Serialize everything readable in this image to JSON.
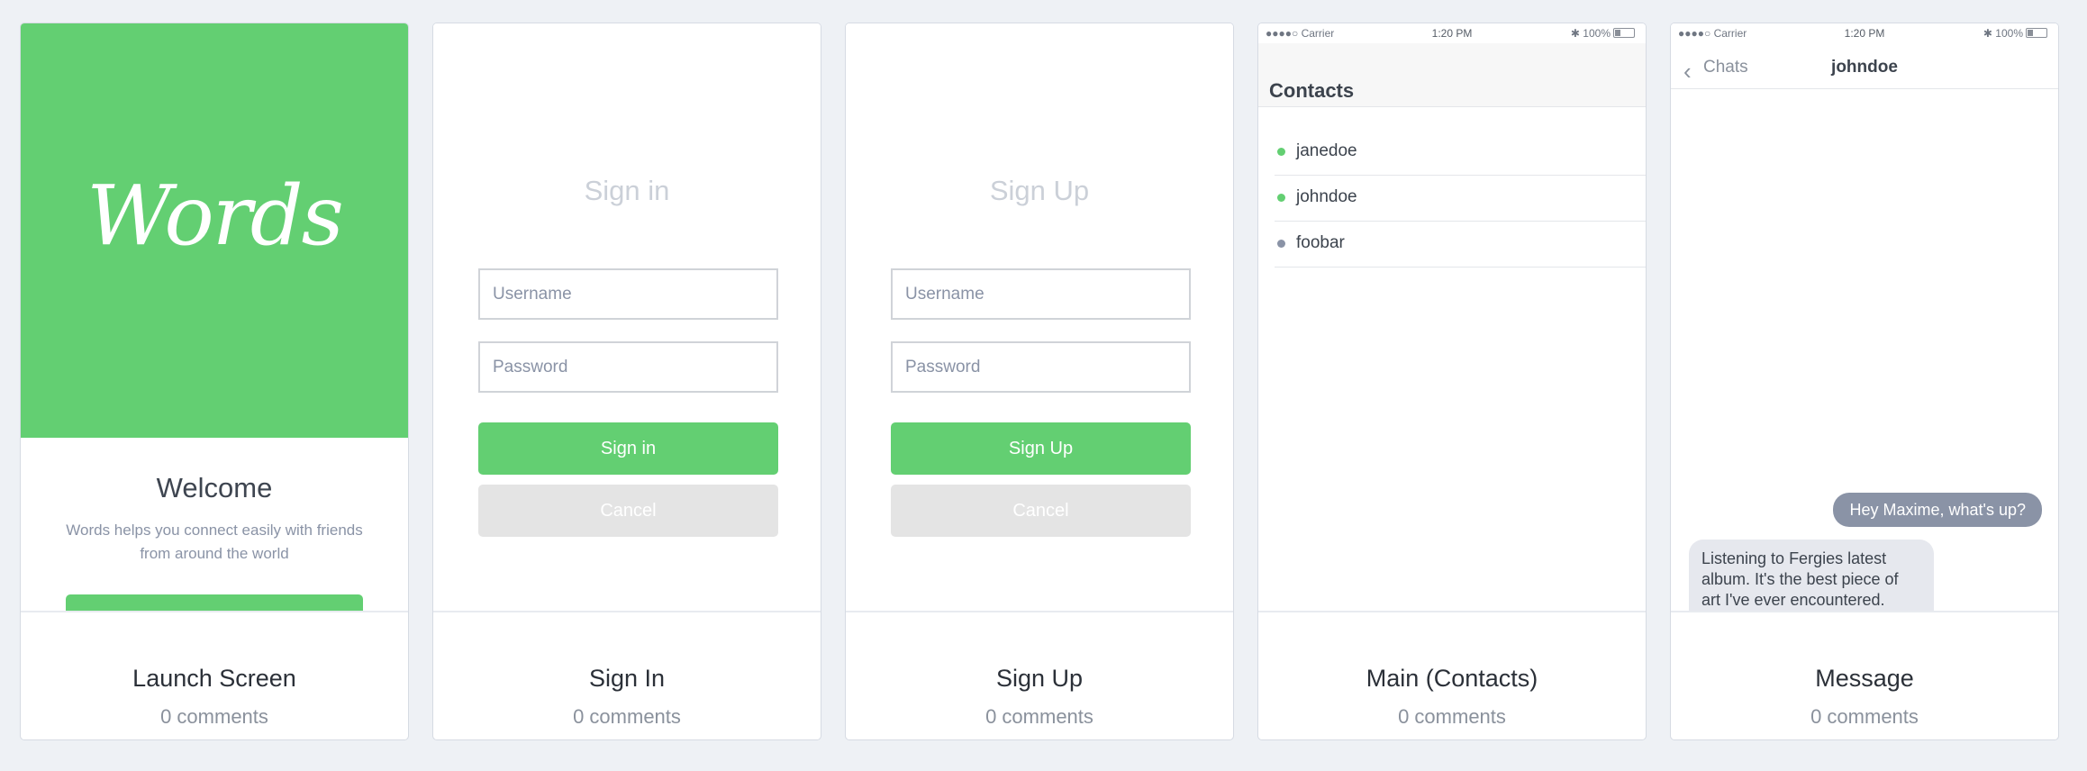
{
  "colors": {
    "accent": "#63cf72",
    "background": "#eef1f5",
    "cancel": "#e4e4e4",
    "bubble_out": "#8a93a6",
    "bubble_in": "#e6e8ee",
    "online": "#63cf72",
    "offline": "#8a93a6"
  },
  "cards": [
    {
      "title": "Launch Screen",
      "comments": "0 comments",
      "screen": {
        "logo": "Words",
        "welcome": "Welcome",
        "description": "Words helps you connect easily with friends from around the world"
      }
    },
    {
      "title": "Sign In",
      "comments": "0 comments",
      "screen": {
        "heading": "Sign in",
        "username_placeholder": "Username",
        "password_placeholder": "Password",
        "primary_button": "Sign in",
        "cancel_button": "Cancel"
      }
    },
    {
      "title": "Sign Up",
      "comments": "0 comments",
      "screen": {
        "heading": "Sign Up",
        "username_placeholder": "Username",
        "password_placeholder": "Password",
        "primary_button": "Sign Up",
        "cancel_button": "Cancel"
      }
    },
    {
      "title": "Main (Contacts)",
      "comments": "0 comments",
      "screen": {
        "status": {
          "carrier": "●●●●○ Carrier",
          "time": "1:20 PM",
          "battery": "100%"
        },
        "heading": "Contacts",
        "contacts": [
          {
            "name": "janedoe",
            "status": "online"
          },
          {
            "name": "johndoe",
            "status": "online"
          },
          {
            "name": "foobar",
            "status": "offline"
          }
        ]
      }
    },
    {
      "title": "Message",
      "comments": "0 comments",
      "screen": {
        "status": {
          "carrier": "●●●●○ Carrier",
          "time": "1:20 PM",
          "battery": "100%"
        },
        "back_label": "Chats",
        "chat_title": "johndoe",
        "messages": [
          {
            "direction": "outgoing",
            "text": "Hey Maxime, what's up?"
          },
          {
            "direction": "incoming",
            "text": "Listening to Fergies latest album. It's the best piece of art I've ever encountered."
          }
        ]
      }
    }
  ]
}
